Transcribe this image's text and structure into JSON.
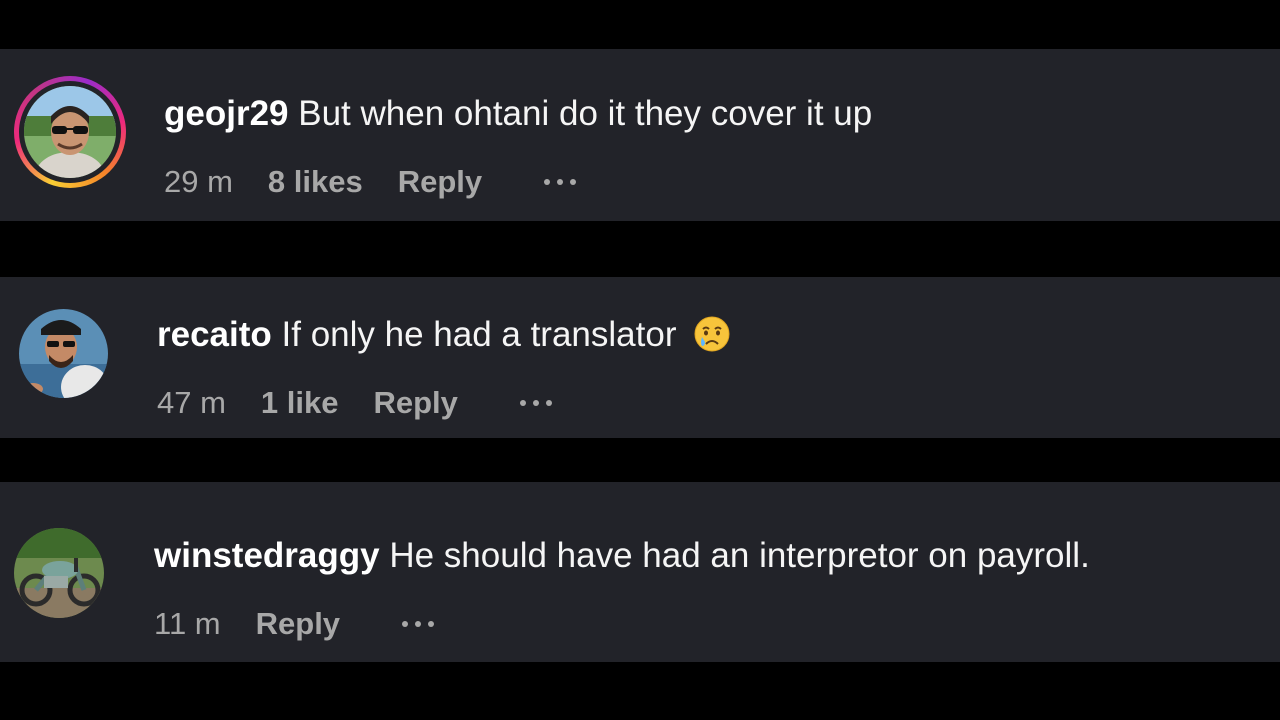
{
  "comments": [
    {
      "username": "geojr29",
      "text": "But when ohtani do it they cover it up",
      "time": "29 m",
      "likes": "8 likes",
      "reply": "Reply",
      "has_story_ring": true,
      "avatar_icon": "user-avatar-icon",
      "more_icon": "more-options-icon"
    },
    {
      "username": "recaito",
      "text": "If only he had a translator",
      "emoji": "crying-face-emoji",
      "time": "47 m",
      "likes": "1 like",
      "reply": "Reply",
      "has_story_ring": false,
      "avatar_icon": "user-avatar-icon",
      "more_icon": "more-options-icon"
    },
    {
      "username": "winstedraggy",
      "text": "He should have had an interpretor on payroll.",
      "time": "11 m",
      "reply": "Reply",
      "has_story_ring": false,
      "avatar_icon": "user-avatar-icon",
      "more_icon": "more-options-icon"
    }
  ],
  "colors": {
    "background": "#000000",
    "card": "#222329",
    "text_primary": "#f5f5f5",
    "text_secondary": "#a8a8a8"
  }
}
